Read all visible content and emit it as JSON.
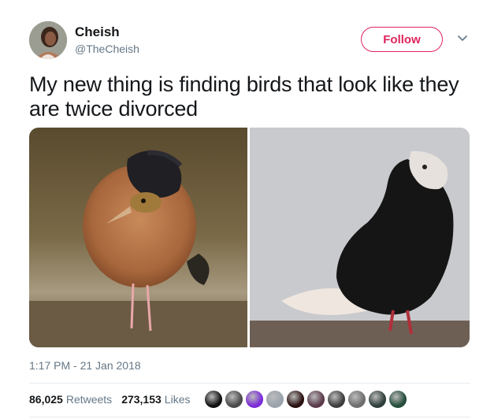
{
  "author": {
    "name": "Cheish",
    "handle": "@TheCheish"
  },
  "follow_button": {
    "label": "Follow"
  },
  "tweet": {
    "text": "My new thing is finding birds that look like they are twice divorced",
    "timestamp": "1:17 PM - 21 Jan 2018"
  },
  "stats": {
    "retweets": {
      "count": "86,025",
      "label": "Retweets"
    },
    "likes": {
      "count": "273,153",
      "label": "Likes"
    }
  },
  "colors": {
    "follow_accent": "#e0245e",
    "secondary_text": "#657786",
    "primary_text": "#14171a",
    "divider": "#e6ecf0"
  },
  "icons": [
    "dropdown-caret-icon"
  ],
  "liker_avatars": [
    {
      "color": "#111111"
    },
    {
      "color": "#4a4a4a"
    },
    {
      "color": "#7b2bd8"
    },
    {
      "color": "#9aa3ad"
    },
    {
      "color": "#2a1010"
    },
    {
      "color": "#5a3a4a"
    },
    {
      "color": "#3d3d3d"
    },
    {
      "color": "#6e6e6e"
    },
    {
      "color": "#2e3e3a"
    },
    {
      "color": "#234d3a"
    }
  ]
}
